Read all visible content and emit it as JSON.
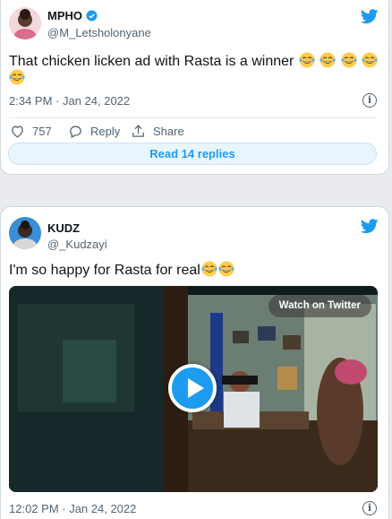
{
  "tweets": [
    {
      "display_name": "MPHO",
      "handle": "@M_Letsholonyane",
      "verified": true,
      "text": "That chicken licken ad with Rasta is a winner",
      "emojis": [
        "face-with-tears-of-joy",
        "face-with-tears-of-joy",
        "face-with-tears-of-joy",
        "face-with-tears-of-joy",
        "face-with-tears-of-joy"
      ],
      "timestamp": "2:34 PM · Jan 24, 2022",
      "like_count": "757",
      "reply_label": "Reply",
      "share_label": "Share",
      "read_replies_label": "Read 14 replies"
    },
    {
      "display_name": "KUDZ",
      "handle": "@_Kudzayi",
      "verified": false,
      "text": "I'm so happy for Rasta for real",
      "emojis": [
        "face-with-tears-of-joy",
        "face-with-tears-of-joy"
      ],
      "video_overlay_label": "Watch on Twitter",
      "timestamp": "12:02 PM · Jan 24, 2022"
    }
  ],
  "icons": {
    "brand": "twitter-bird-icon",
    "info": "info-icon",
    "like": "heart-icon",
    "reply": "reply-icon",
    "share": "share-icon",
    "play": "play-icon",
    "verified": "verified-badge-icon"
  },
  "colors": {
    "twitter_blue": "#1d9bf0",
    "text_primary": "#0f1419",
    "text_secondary": "#536471",
    "page_background": "#e9ebee"
  }
}
